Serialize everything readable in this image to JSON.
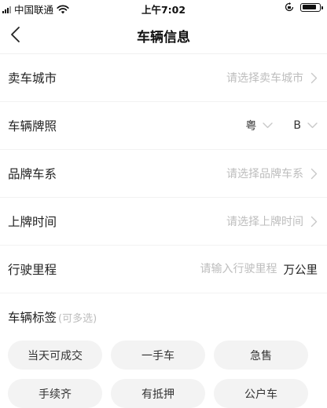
{
  "status_bar": {
    "carrier": "中国联通",
    "time": "上午7:02",
    "battery_level": 0.85
  },
  "nav": {
    "title": "车辆信息"
  },
  "form": {
    "sell_city": {
      "label": "卖车城市",
      "placeholder": "请选择卖车城市"
    },
    "plate": {
      "label": "车辆牌照",
      "province": "粤",
      "letter": "B"
    },
    "brand_series": {
      "label": "品牌车系",
      "placeholder": "请选择品牌车系"
    },
    "plate_time": {
      "label": "上牌时间",
      "placeholder": "请选择上牌时间"
    },
    "mileage": {
      "label": "行驶里程",
      "placeholder": "请输入行驶里程",
      "unit": "万公里"
    }
  },
  "tags": {
    "title": "车辆标签",
    "hint": "(可多选)",
    "items": [
      "当天可成交",
      "一手车",
      "急售",
      "手续齐",
      "有抵押",
      "公户车"
    ]
  },
  "colors": {
    "chip_bg": "#f3f3f3",
    "placeholder": "#bdbdbd"
  },
  "icons": [
    "back-arrow-icon",
    "chevron-right-icon",
    "chevron-down-icon",
    "wifi-icon",
    "battery-icon",
    "orientation-lock-icon"
  ]
}
